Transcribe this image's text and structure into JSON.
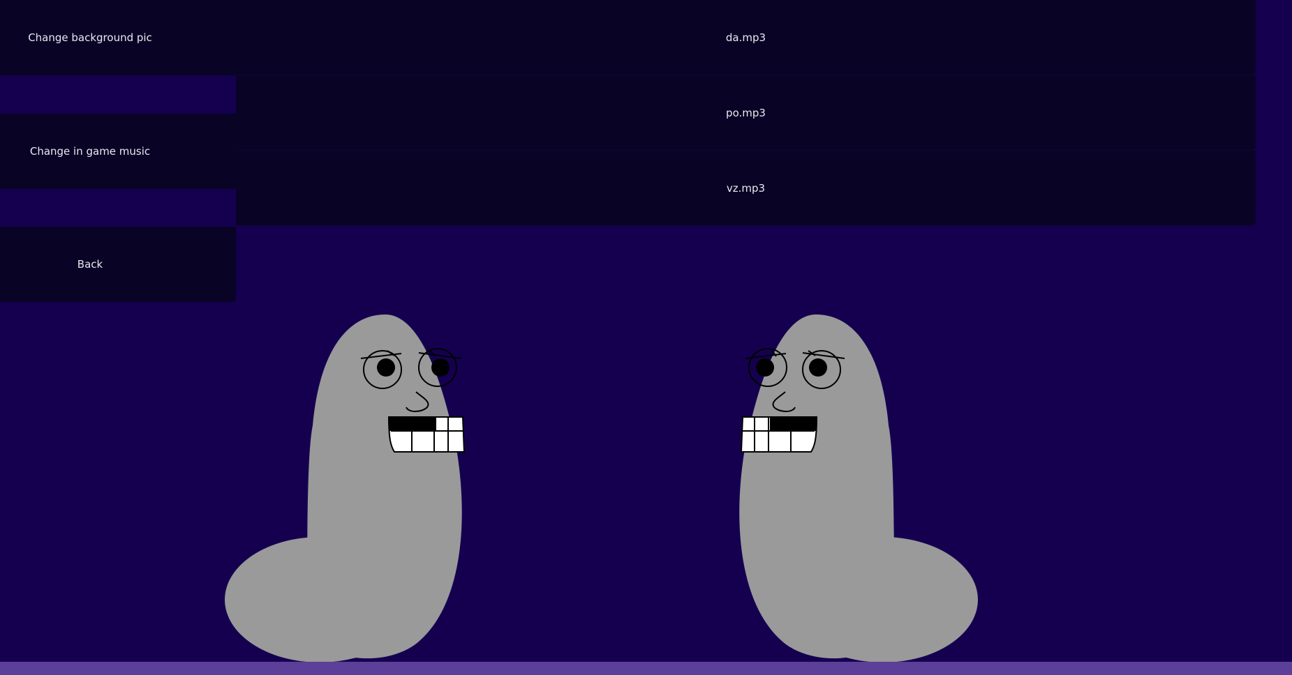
{
  "menu": {
    "change_background_label": "Change background pic",
    "change_music_label": "Change in game music",
    "back_label": "Back"
  },
  "tracks": [
    {
      "label": "da.mp3"
    },
    {
      "label": "po.mp3"
    },
    {
      "label": "vz.mp3"
    }
  ],
  "colors": {
    "background": "#150050",
    "button": "#090426",
    "button_text": "#e8e8ee",
    "ground": "#5c3f98",
    "character_body": "#9a9a9a"
  },
  "scene": {
    "characters": [
      "worm-character",
      "worm-character"
    ]
  }
}
